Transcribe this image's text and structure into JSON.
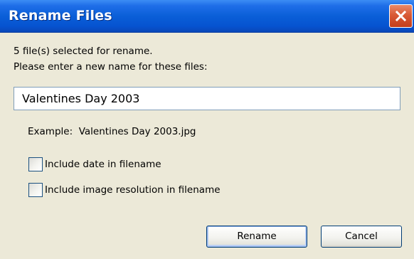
{
  "window": {
    "title": "Rename Files"
  },
  "titlebar": {
    "close_icon": "close-icon"
  },
  "message": {
    "line1": "5 file(s) selected for rename.",
    "line2": "Please enter a new name for these files:"
  },
  "name_field": {
    "value": "Valentines Day 2003"
  },
  "example": {
    "text": "Example:  Valentines Day 2003.jpg"
  },
  "options": {
    "include_date": {
      "label": "Include date in filename",
      "checked": false
    },
    "include_resolution": {
      "label": "Include image resolution in filename",
      "checked": false
    }
  },
  "buttons": {
    "rename": "Rename",
    "cancel": "Cancel"
  },
  "colors": {
    "titlebar": "#0a5fd8",
    "close_button": "#d95a35",
    "dialog_background": "#ece9d8"
  }
}
